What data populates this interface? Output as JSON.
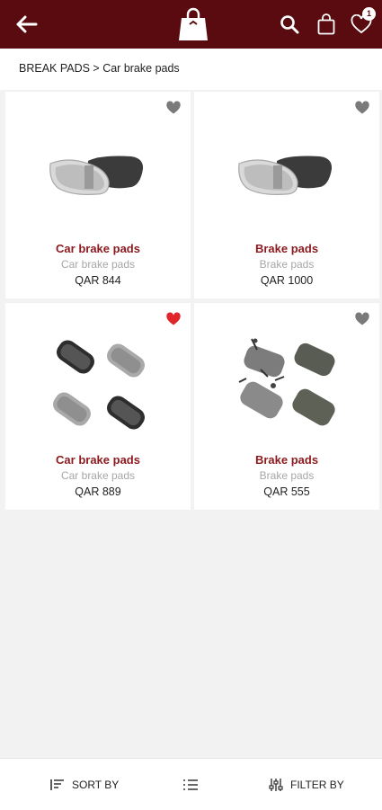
{
  "header": {
    "back_icon": "arrow-left-icon",
    "logo_icon": "shopping-bag-logo",
    "search_icon": "search-icon",
    "bag_icon": "shopping-bag-icon",
    "wishlist_icon": "heart-outline-icon",
    "wishlist_count": "1",
    "bg_color": "#5a0b10"
  },
  "breadcrumb": "BREAK PADS > Car brake pads",
  "products": [
    {
      "name": "Car brake pads",
      "subtitle": "Car brake pads",
      "price": "QAR 844",
      "favorited": false
    },
    {
      "name": "Brake pads",
      "subtitle": "Brake pads",
      "price": "QAR 1000",
      "favorited": false
    },
    {
      "name": "Car brake pads",
      "subtitle": "Car brake pads",
      "price": "QAR 889",
      "favorited": true
    },
    {
      "name": "Brake pads",
      "subtitle": "Brake pads",
      "price": "QAR 555",
      "favorited": false
    }
  ],
  "bottom_bar": {
    "sort_label": "SORT BY",
    "view_icon": "list-view-icon",
    "filter_label": "FILTER BY"
  },
  "colors": {
    "accent": "#8b1a1f",
    "favorite": "#e0262b",
    "heart_inactive": "#7a7a7a"
  }
}
